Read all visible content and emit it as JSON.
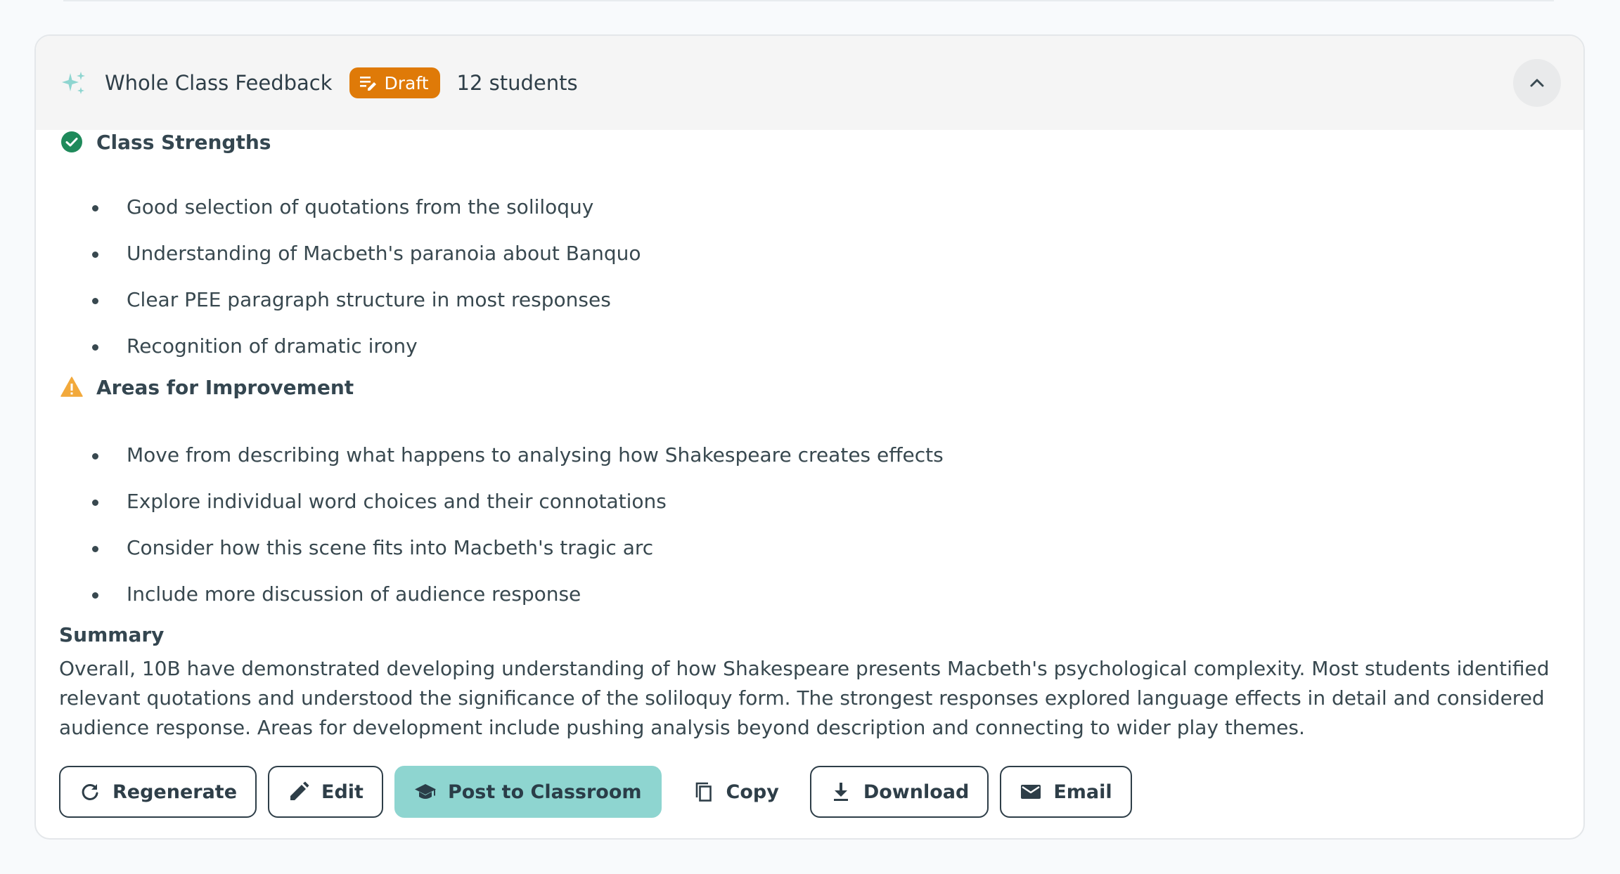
{
  "header": {
    "title": "Whole Class Feedback",
    "badge": "Draft",
    "student_count": "12 students"
  },
  "strengths": {
    "title": "Class Strengths",
    "items": [
      "Good selection of quotations from the soliloquy",
      "Understanding of Macbeth's paranoia about Banquo",
      "Clear PEE paragraph structure in most responses",
      "Recognition of dramatic irony"
    ]
  },
  "improvements": {
    "title": "Areas for Improvement",
    "items": [
      "Move from describing what happens to analysing how Shakespeare creates effects",
      "Explore individual word choices and their connotations",
      "Consider how this scene fits into Macbeth's tragic arc",
      "Include more discussion of audience response"
    ]
  },
  "summary": {
    "title": "Summary",
    "text": "Overall, 10B have demonstrated developing understanding of how Shakespeare presents Macbeth's psychological complexity. Most students identified relevant quotations and understood the significance of the soliloquy form. The strongest responses explored language effects in detail and considered audience response. Areas for development include pushing analysis beyond description and connecting to wider play themes."
  },
  "actions": {
    "regenerate": "Regenerate",
    "edit": "Edit",
    "post": "Post to Classroom",
    "copy": "Copy",
    "download": "Download",
    "email": "Email"
  },
  "colors": {
    "accent": "#8ed5d0",
    "draft": "#df7a08",
    "success": "#1f8a5b",
    "warning": "#f2a93b"
  },
  "icons": {
    "header": "sparkle-icon",
    "collapse": "chevron-up-icon",
    "strengths": "check-circle-icon",
    "improvements": "warning-icon"
  }
}
